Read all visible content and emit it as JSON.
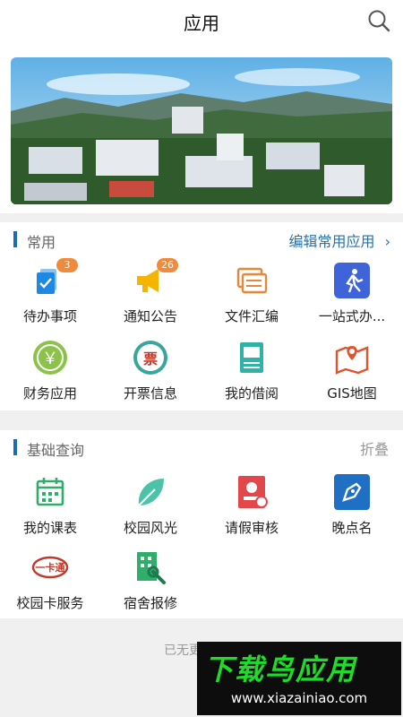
{
  "header": {
    "title": "应用"
  },
  "common": {
    "title": "常用",
    "action": "编辑常用应用",
    "apps": [
      {
        "label": "待办事项",
        "badge": "3"
      },
      {
        "label": "通知公告",
        "badge": "26"
      },
      {
        "label": "文件汇编"
      },
      {
        "label": "一站式办..."
      },
      {
        "label": "财务应用"
      },
      {
        "label": "开票信息"
      },
      {
        "label": "我的借阅"
      },
      {
        "label": "GIS地图"
      }
    ]
  },
  "basic": {
    "title": "基础查询",
    "action": "折叠",
    "apps": [
      {
        "label": "我的课表"
      },
      {
        "label": "校园风光"
      },
      {
        "label": "请假审核"
      },
      {
        "label": "晚点名"
      },
      {
        "label": "校园卡服务"
      },
      {
        "label": "宿舍报修"
      }
    ]
  },
  "footer": {
    "text": "已无更多内容"
  },
  "watermark": {
    "title": "下载鸟应用",
    "url": "www.xiazainiao.com"
  },
  "icons": {
    "fin": "￥",
    "ticket": "票",
    "card": "一卡通"
  }
}
